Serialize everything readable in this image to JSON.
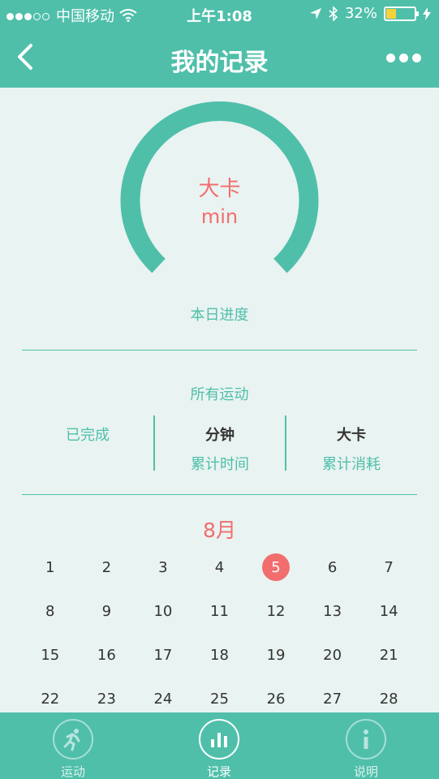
{
  "status_bar": {
    "carrier": "中国移动",
    "time": "上午1:08",
    "battery": "32%"
  },
  "nav": {
    "title": "我的记录"
  },
  "gauge": {
    "unit_calories": "大卡",
    "unit_minutes": "min",
    "label": "本日进度"
  },
  "summary": {
    "title": "所有运动",
    "stats": [
      {
        "value": "已完成",
        "label": ""
      },
      {
        "value": "分钟",
        "label": "累计时间"
      },
      {
        "value": "大卡",
        "label": "累计消耗"
      }
    ]
  },
  "calendar": {
    "month": "8月",
    "selected_day": "5",
    "rows": [
      [
        "1",
        "2",
        "3",
        "4",
        "5",
        "6",
        "7"
      ],
      [
        "8",
        "9",
        "10",
        "11",
        "12",
        "13",
        "14"
      ],
      [
        "15",
        "16",
        "17",
        "18",
        "19",
        "20",
        "21"
      ],
      [
        "22",
        "23",
        "24",
        "25",
        "26",
        "27",
        "28"
      ]
    ]
  },
  "tabs": [
    {
      "label": "运动",
      "icon": "run-icon",
      "active": false
    },
    {
      "label": "记录",
      "icon": "chart-icon",
      "active": true
    },
    {
      "label": "说明",
      "icon": "info-icon",
      "active": false
    }
  ],
  "colors": {
    "primary": "#4fbfaa",
    "accent": "#f26d6d",
    "background": "#e9f3f1"
  }
}
